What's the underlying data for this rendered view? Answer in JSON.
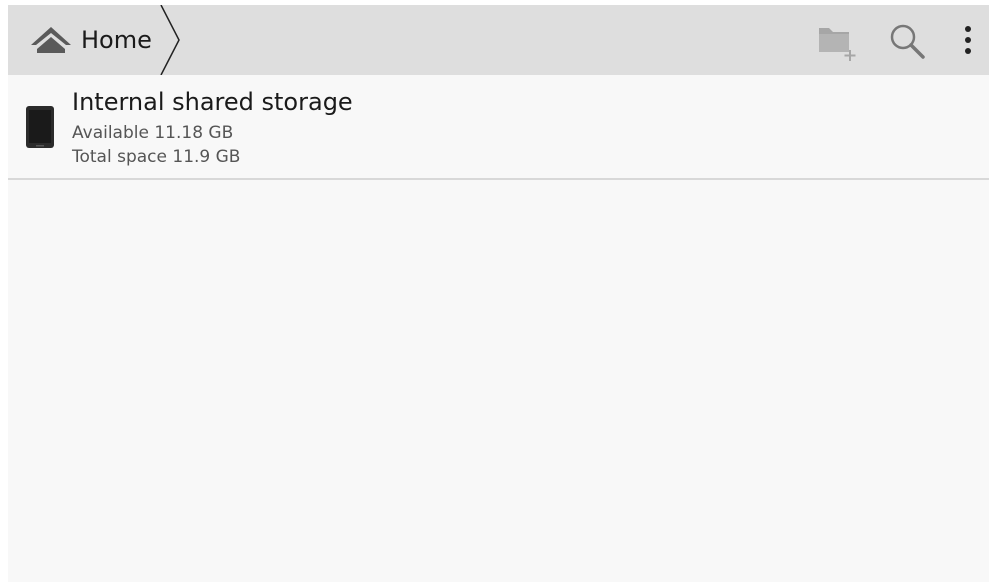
{
  "action_bar": {
    "breadcrumb": {
      "home_label": "Home",
      "home_icon": "home-icon",
      "separator_icon": "chevron-right-icon"
    },
    "actions": [
      {
        "name": "new-folder",
        "icon": "new-folder-icon",
        "enabled": false
      },
      {
        "name": "search",
        "icon": "search-icon",
        "enabled": true
      },
      {
        "name": "overflow-menu",
        "icon": "more-vert-icon",
        "enabled": true
      }
    ]
  },
  "storage_list": [
    {
      "icon": "device-icon",
      "title": "Internal shared storage",
      "available": "Available 11.18 GB",
      "total": "Total space 11.9 GB"
    }
  ],
  "colors": {
    "action_bar_bg": "#dedede",
    "content_bg": "#f8f8f8",
    "primary_text": "#1a1a1a",
    "secondary_text": "#555555",
    "divider": "#d8d8d8"
  }
}
